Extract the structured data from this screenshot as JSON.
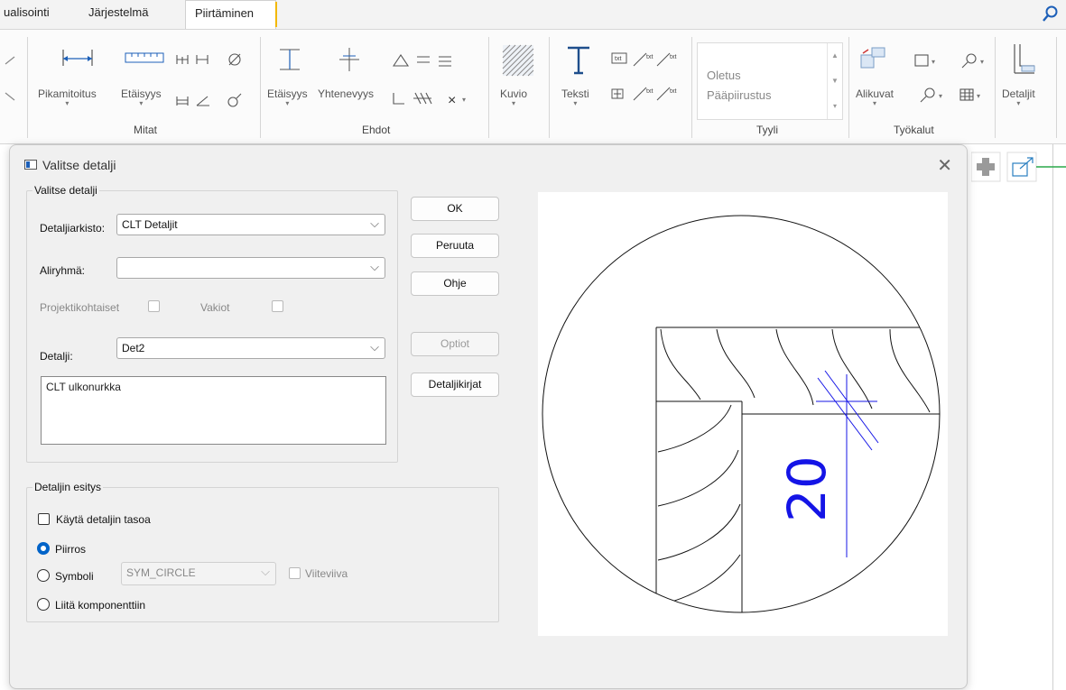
{
  "ribbon": {
    "tabs": [
      {
        "label": "ualisointi"
      },
      {
        "label": "Järjestelmä"
      },
      {
        "label": "Piirtäminen"
      }
    ],
    "search_icon": "search-icon",
    "groups": {
      "mitat": {
        "label": "Mitat",
        "pikamitoitus": "Pikamitoitus",
        "etaisyys": "Etäisyys"
      },
      "ehdot": {
        "label": "Ehdot",
        "etaisyys": "Etäisyys",
        "yhtenevyys": "Yhtenevyys"
      },
      "kuvio": {
        "label": "Kuvio"
      },
      "teksti": {
        "label": "Teksti"
      },
      "tyyli": {
        "label": "Tyyli",
        "line1": "Oletus",
        "line2": "Pääpiirustus"
      },
      "tyokalut": {
        "label": "Työkalut",
        "alikuvat": "Alikuvat"
      },
      "detaljit": {
        "label": "Detaljit"
      }
    }
  },
  "dialog": {
    "title": "Valitse detalji",
    "group1": {
      "legend": "Valitse detalji",
      "archive_label": "Detaljiarkisto:",
      "archive_value": "CLT Detaljit",
      "subgroup_label": "Aliryhmä:",
      "subgroup_value": "",
      "project_label": "Projektikohtaiset",
      "constants_label": "Vakiot",
      "detail_label": "Detalji:",
      "detail_value": "Det2",
      "description": "CLT ulkonurkka"
    },
    "buttons": {
      "ok": "OK",
      "cancel": "Peruuta",
      "help": "Ohje",
      "options": "Optiot",
      "libraries": "Detaljikirjat"
    },
    "group2": {
      "legend": "Detaljin esitys",
      "use_level_label": "Käytä detaljin tasoa",
      "use_level_checked": false,
      "radio_drawing": "Piirros",
      "radio_symbol": "Symboli",
      "symbol_value": "SYM_CIRCLE",
      "leader_label": "Viiteviiva",
      "radio_attach": "Liitä komponenttiin",
      "selected": "Piirros"
    },
    "preview": {
      "label_text": "20",
      "label_color": "#1414e6"
    }
  }
}
